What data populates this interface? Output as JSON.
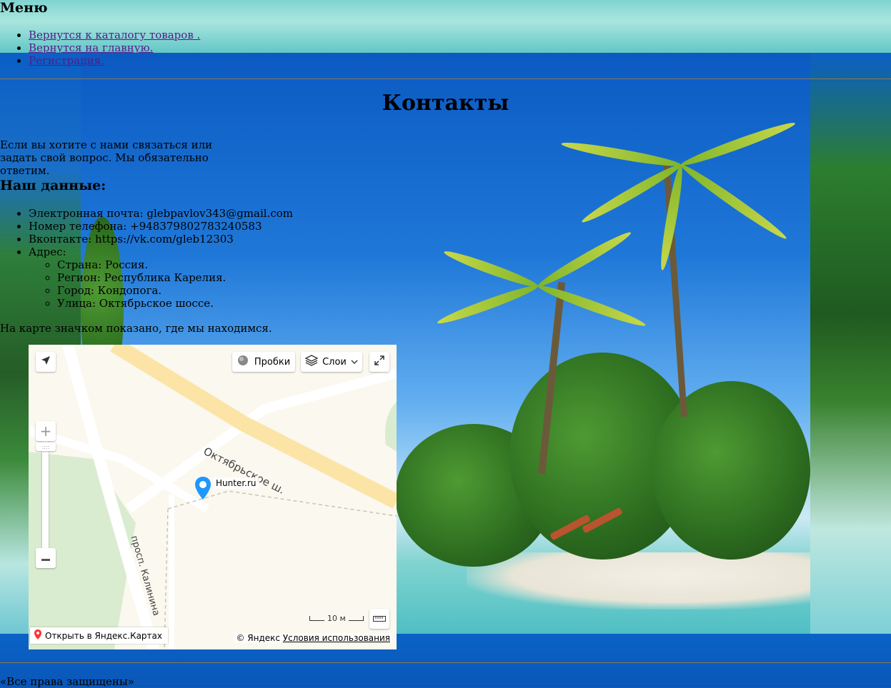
{
  "menu": {
    "title": "Меню",
    "items": [
      {
        "label": "Вернутся к каталогу товаров ."
      },
      {
        "label": "Вернутся на главную."
      },
      {
        "label": "Регистрация."
      }
    ]
  },
  "page": {
    "title": "Контакты",
    "intro": "Если вы хотите с нами связаться или задать свой вопрос. Мы обязательно ответим.",
    "data_title": "Наш данные:",
    "contacts": [
      {
        "text": "Электронная почта: glebpavlov343@gmail.com"
      },
      {
        "text": "Номер телефона: +948379802783240583"
      },
      {
        "text": "Вконтакте: https://vk.com/gleb12303"
      },
      {
        "text": "Адрес:"
      }
    ],
    "address": [
      {
        "text": "Страна: Россия."
      },
      {
        "text": "Регион: Республика Карелия."
      },
      {
        "text": "Город: Кондопога."
      },
      {
        "text": "Улица: Октябрьское шоссе."
      }
    ],
    "map_note": "На карте значком показано, где мы находимся.",
    "footer": "«Все права защищены»"
  },
  "map": {
    "traffic_label": "Пробки",
    "layers_label": "Слои",
    "street_1": "Октябрьское ш.",
    "street_2": "просп. Калинина",
    "pin_label": "Hunter.ru",
    "scale_label": "10 м",
    "open_link": "Открыть в Яндекс.Картах",
    "copyright": "© Яндекс",
    "terms": "Условия использования",
    "icons": {
      "locate": "navigation-arrow-icon",
      "traffic": "traffic-icon",
      "layers": "layers-icon",
      "fullscreen": "fullscreen-icon",
      "zoom_in": "plus-icon",
      "zoom_out": "minus-icon",
      "ruler": "ruler-icon",
      "pin": "map-pin-icon"
    },
    "colors": {
      "main_road": "#fbe4a6",
      "park": "#d9ecd0",
      "pin": "#1e98ff"
    }
  }
}
